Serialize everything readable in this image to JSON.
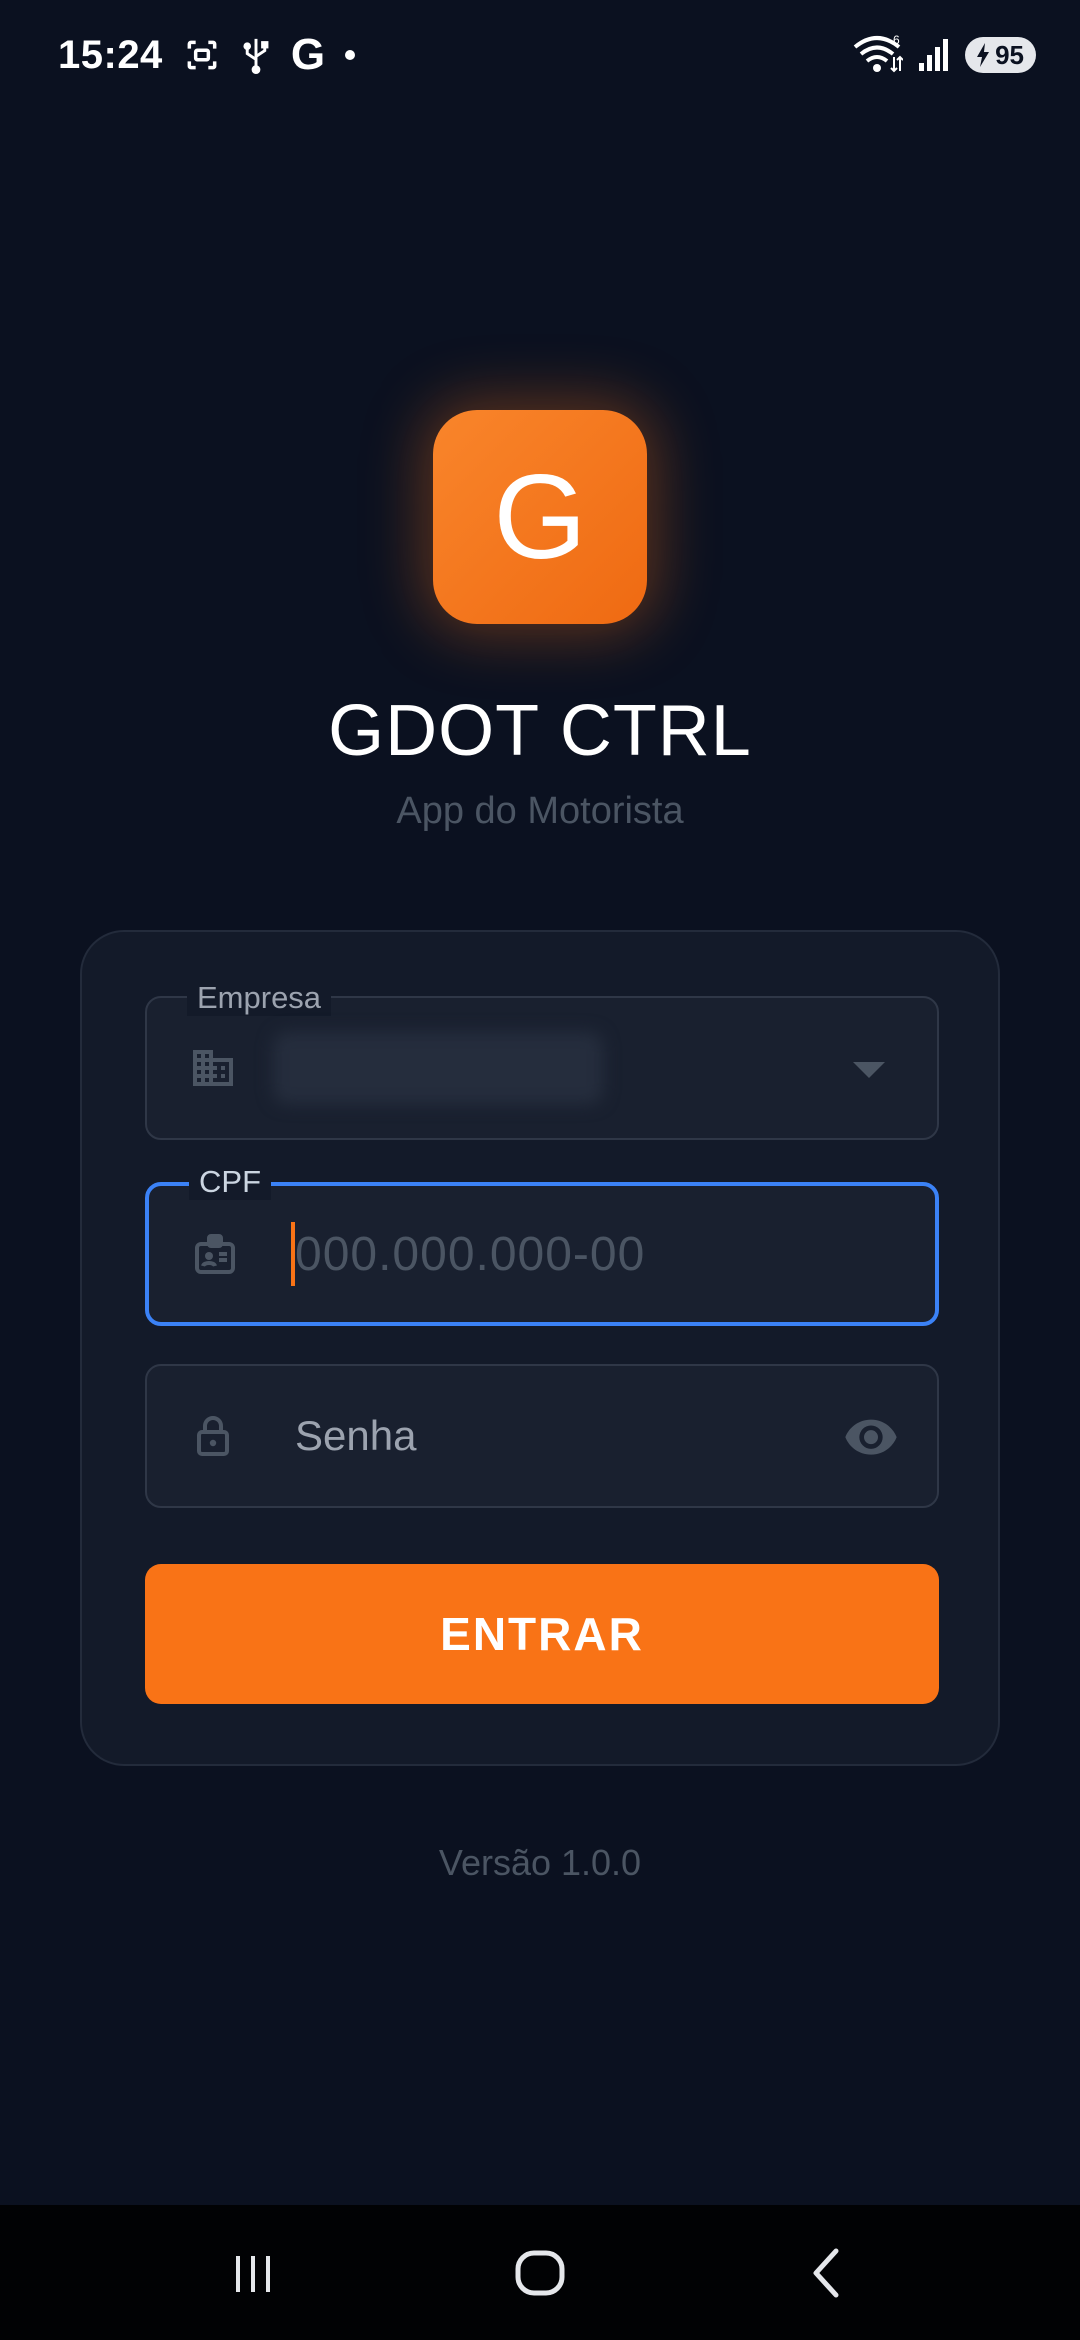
{
  "status_bar": {
    "time": "15:24",
    "notification_letter": "G",
    "battery_level": "95",
    "network_badge": "6"
  },
  "app": {
    "logo_letter": "G",
    "title": "GDOT CTRL",
    "subtitle": "App do Motorista",
    "accent_color": "#f97316"
  },
  "form": {
    "empresa_label": "Empresa",
    "cpf_label": "CPF",
    "cpf_placeholder": "000.000.000-00",
    "senha_placeholder": "Senha",
    "submit_label": "ENTRAR"
  },
  "footer": {
    "version": "Versão 1.0.0"
  },
  "icons": {
    "empresa": "building-icon",
    "cpf": "id-badge-icon",
    "senha": "lock-icon",
    "toggle_password": "eye-icon"
  }
}
